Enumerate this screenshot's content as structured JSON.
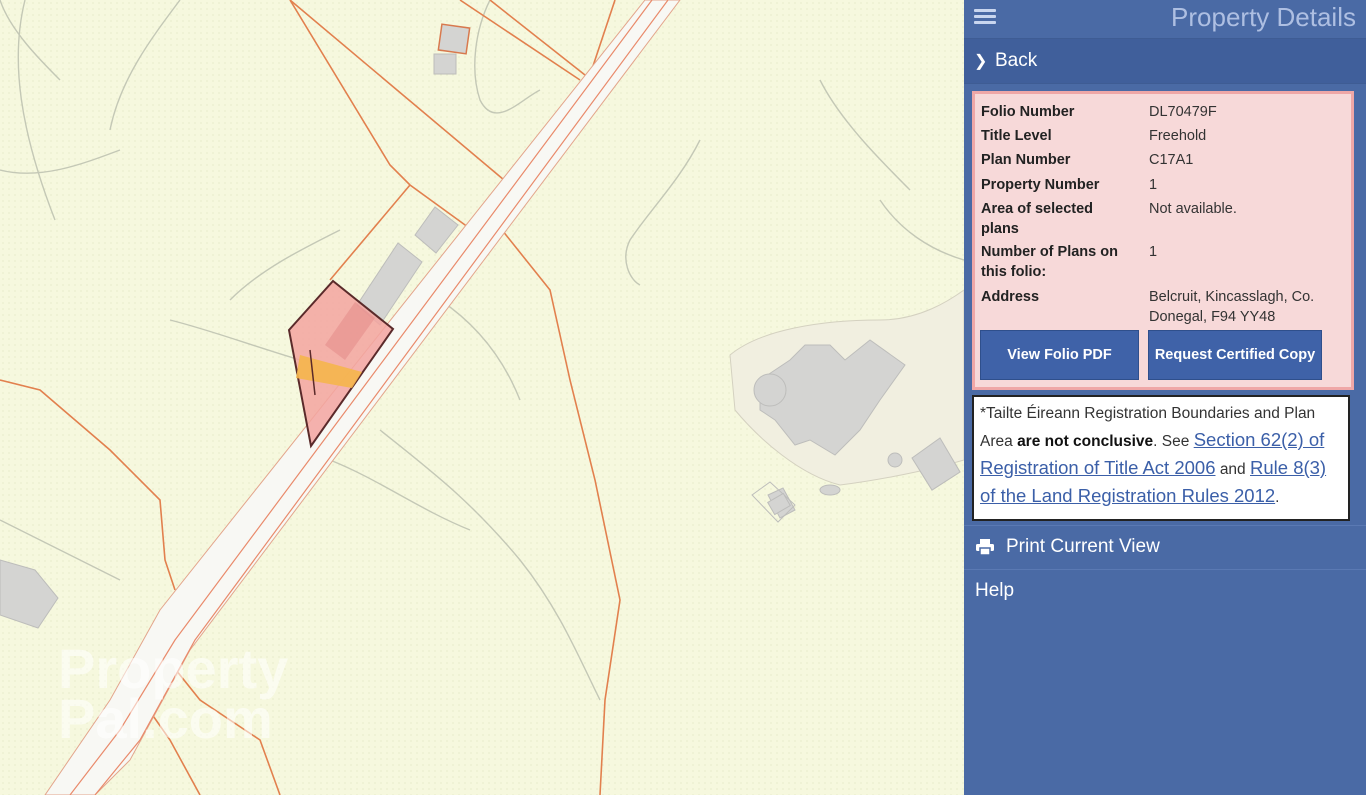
{
  "panel": {
    "title": "Property Details",
    "back_label": "Back",
    "details": [
      {
        "key": "Folio Number",
        "value": "DL70479F"
      },
      {
        "key": "Title Level",
        "value": "Freehold"
      },
      {
        "key": "Plan Number",
        "value": "C17A1"
      },
      {
        "key": "Property Number",
        "value": "1"
      },
      {
        "key": "Area of selected plans",
        "value": "Not available."
      },
      {
        "key": "Number of Plans on this folio:",
        "value": "1"
      },
      {
        "key": "Address",
        "value": "Belcruit, Kincasslagh, Co. Donegal, F94 YY48"
      }
    ],
    "view_pdf_label": "View Folio PDF",
    "certified_copy_label": "Request Certified Copy",
    "note": {
      "prefix": "*Tailte Éireann Registration Boundaries and Plan Area",
      "bold": "are not conclusive",
      "mid": ". See",
      "link1": "Section 62(2) of Registration of Title Act 2006",
      "and": "and",
      "link2": "Rule 8(3) of the Land Registration Rules 2012",
      "end": "."
    },
    "print_label": "Print Current View",
    "help_label": "Help"
  },
  "map": {
    "watermark_lines": [
      "Property",
      "Pal.com"
    ]
  },
  "colors": {
    "panel_bg": "#4a6aa5",
    "map_bg": "#f5f7dc",
    "parcel_fill": "#f3a5a0",
    "boundary_line": "#e2804e"
  }
}
